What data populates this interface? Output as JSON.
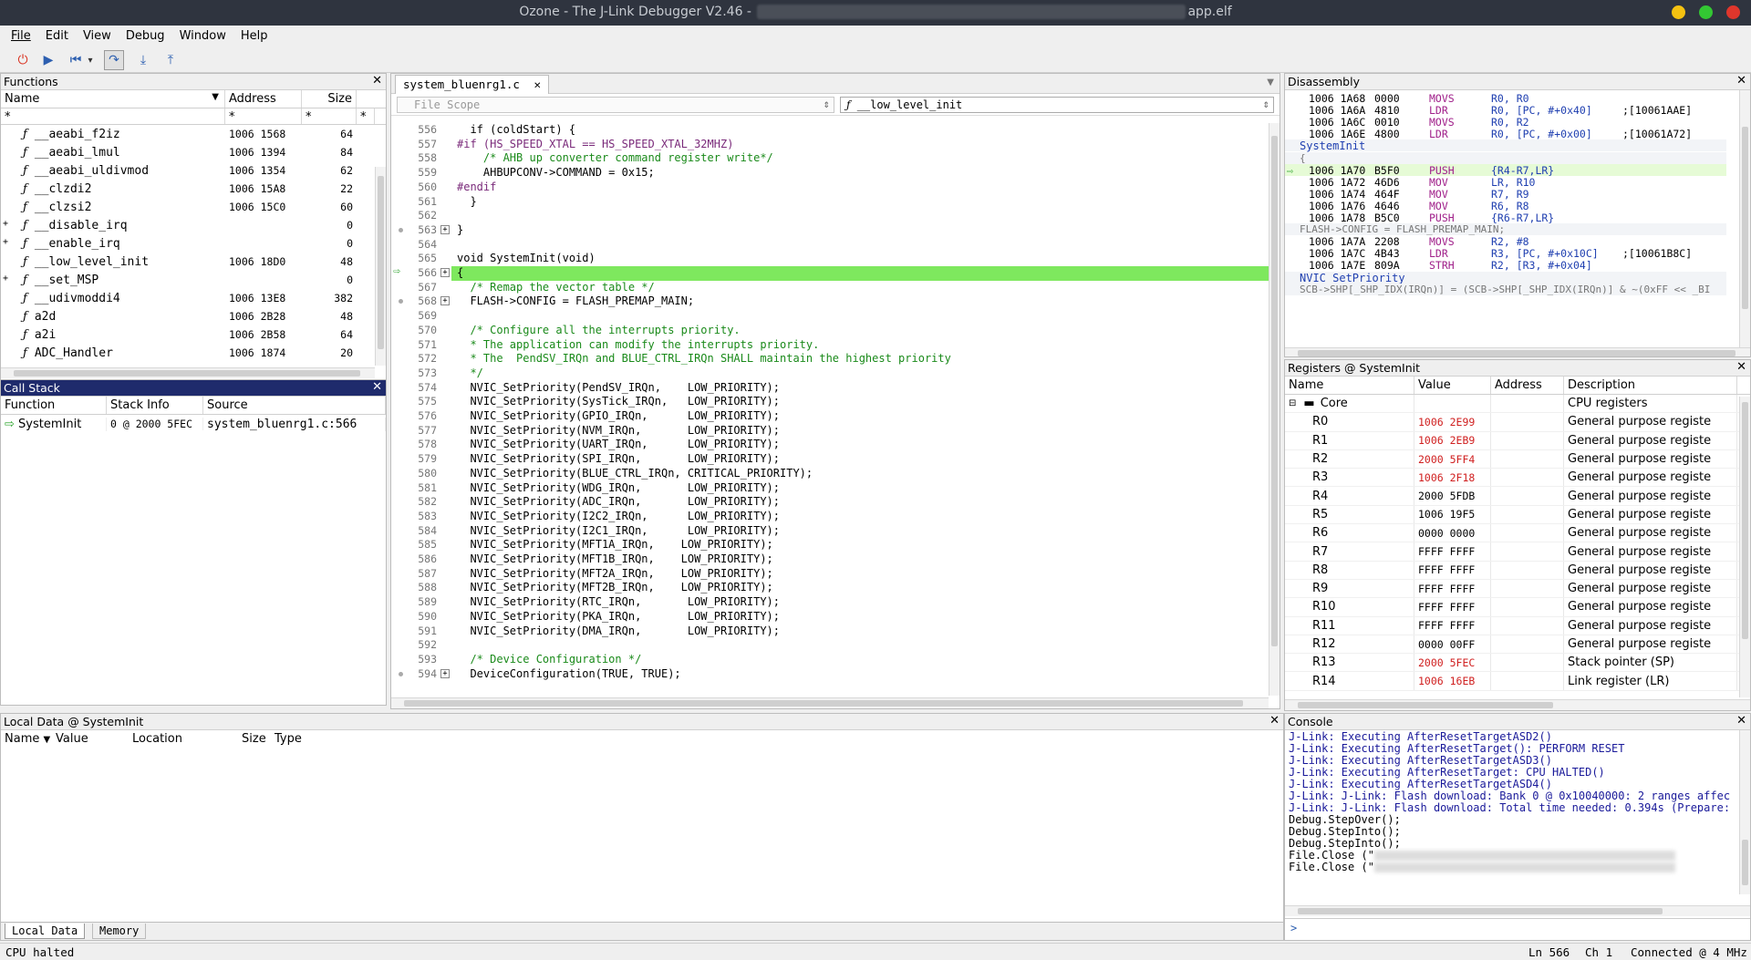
{
  "window": {
    "title_prefix": "Ozone - The J-Link Debugger V2.46 -",
    "title_suffix": "app.elf"
  },
  "menu": [
    "File",
    "Edit",
    "View",
    "Debug",
    "Window",
    "Help"
  ],
  "functions": {
    "title": "Functions",
    "headers": [
      "Name",
      "Address",
      "Size"
    ],
    "filter": [
      "*",
      "*",
      "*",
      "*"
    ],
    "rows": [
      {
        "name": "__aeabi_f2iz",
        "address": "1006 1568",
        "size": "64",
        "exp": ""
      },
      {
        "name": "__aeabi_lmul",
        "address": "1006 1394",
        "size": "84",
        "exp": ""
      },
      {
        "name": "__aeabi_uldivmod",
        "address": "1006 1354",
        "size": "62",
        "exp": ""
      },
      {
        "name": "__clzdi2",
        "address": "1006 15A8",
        "size": "22",
        "exp": ""
      },
      {
        "name": "__clzsi2",
        "address": "1006 15C0",
        "size": "60",
        "exp": ""
      },
      {
        "name": "__disable_irq",
        "address": "",
        "size": "0",
        "exp": "+"
      },
      {
        "name": "__enable_irq",
        "address": "",
        "size": "0",
        "exp": "+"
      },
      {
        "name": "__low_level_init",
        "address": "1006 18D0",
        "size": "48",
        "exp": ""
      },
      {
        "name": "__set_MSP",
        "address": "",
        "size": "0",
        "exp": "+"
      },
      {
        "name": "__udivmoddi4",
        "address": "1006 13E8",
        "size": "382",
        "exp": ""
      },
      {
        "name": "a2d",
        "address": "1006 2B28",
        "size": "48",
        "exp": ""
      },
      {
        "name": "a2i",
        "address": "1006 2B58",
        "size": "64",
        "exp": ""
      },
      {
        "name": "ADC_Handler",
        "address": "1006 1874",
        "size": "20",
        "exp": ""
      }
    ]
  },
  "callstack": {
    "title": "Call Stack",
    "headers": [
      "Function",
      "Stack Info",
      "Source"
    ],
    "rows": [
      {
        "function": "SystemInit",
        "stack": "0 @ 2000 5FEC",
        "source": "system_bluenrg1.c:566"
      }
    ]
  },
  "localdata": {
    "title": "Local Data @ SystemInit",
    "headers": [
      "Name",
      "Value",
      "Location",
      "Size",
      "Type"
    ],
    "tabs": [
      "Local Data",
      "Memory"
    ]
  },
  "editor": {
    "tab": "system_bluenrg1.c",
    "scope": "File Scope",
    "function": "__low_level_init",
    "lines": [
      {
        "n": "556",
        "t": "  if (coldStart) {",
        "c": ""
      },
      {
        "n": "557",
        "t": "#if (HS_SPEED_XTAL == HS_SPEED_XTAL_32MHZ)",
        "c": "pp"
      },
      {
        "n": "558",
        "t": "    /* AHB up converter command register write*/",
        "c": "cm"
      },
      {
        "n": "559",
        "t": "    AHBUPCONV->COMMAND = 0x15;",
        "c": ""
      },
      {
        "n": "560",
        "t": "#endif",
        "c": "pp"
      },
      {
        "n": "561",
        "t": "  }",
        "c": ""
      },
      {
        "n": "562",
        "t": "",
        "c": ""
      },
      {
        "n": "563",
        "t": "}",
        "c": "",
        "mk": "+"
      },
      {
        "n": "564",
        "t": "",
        "c": ""
      },
      {
        "n": "565",
        "t": "void SystemInit(void)",
        "c": ""
      },
      {
        "n": "566",
        "t": "{",
        "c": "",
        "mk": "+",
        "cur": "1"
      },
      {
        "n": "567",
        "t": "  /* Remap the vector table */",
        "c": "cm"
      },
      {
        "n": "568",
        "t": "  FLASH->CONFIG = FLASH_PREMAP_MAIN;",
        "c": "",
        "mk": "+"
      },
      {
        "n": "569",
        "t": "",
        "c": ""
      },
      {
        "n": "570",
        "t": "  /* Configure all the interrupts priority.",
        "c": "cm"
      },
      {
        "n": "571",
        "t": "  * The application can modify the interrupts priority.",
        "c": "cm"
      },
      {
        "n": "572",
        "t": "  * The  PendSV_IRQn and BLUE_CTRL_IRQn SHALL maintain the highest priority",
        "c": "cm"
      },
      {
        "n": "573",
        "t": "  */",
        "c": "cm"
      },
      {
        "n": "574",
        "t": "  NVIC_SetPriority(PendSV_IRQn,    LOW_PRIORITY);",
        "c": ""
      },
      {
        "n": "575",
        "t": "  NVIC_SetPriority(SysTick_IRQn,   LOW_PRIORITY);",
        "c": ""
      },
      {
        "n": "576",
        "t": "  NVIC_SetPriority(GPIO_IRQn,      LOW_PRIORITY);",
        "c": ""
      },
      {
        "n": "577",
        "t": "  NVIC_SetPriority(NVM_IRQn,       LOW_PRIORITY);",
        "c": ""
      },
      {
        "n": "578",
        "t": "  NVIC_SetPriority(UART_IRQn,      LOW_PRIORITY);",
        "c": ""
      },
      {
        "n": "579",
        "t": "  NVIC_SetPriority(SPI_IRQn,       LOW_PRIORITY);",
        "c": ""
      },
      {
        "n": "580",
        "t": "  NVIC_SetPriority(BLUE_CTRL_IRQn, CRITICAL_PRIORITY);",
        "c": ""
      },
      {
        "n": "581",
        "t": "  NVIC_SetPriority(WDG_IRQn,       LOW_PRIORITY);",
        "c": ""
      },
      {
        "n": "582",
        "t": "  NVIC_SetPriority(ADC_IRQn,       LOW_PRIORITY);",
        "c": ""
      },
      {
        "n": "583",
        "t": "  NVIC_SetPriority(I2C2_IRQn,      LOW_PRIORITY);",
        "c": ""
      },
      {
        "n": "584",
        "t": "  NVIC_SetPriority(I2C1_IRQn,      LOW_PRIORITY);",
        "c": ""
      },
      {
        "n": "585",
        "t": "  NVIC_SetPriority(MFT1A_IRQn,    LOW_PRIORITY);",
        "c": ""
      },
      {
        "n": "586",
        "t": "  NVIC_SetPriority(MFT1B_IRQn,    LOW_PRIORITY);",
        "c": ""
      },
      {
        "n": "587",
        "t": "  NVIC_SetPriority(MFT2A_IRQn,    LOW_PRIORITY);",
        "c": ""
      },
      {
        "n": "588",
        "t": "  NVIC_SetPriority(MFT2B_IRQn,    LOW_PRIORITY);",
        "c": ""
      },
      {
        "n": "589",
        "t": "  NVIC_SetPriority(RTC_IRQn,       LOW_PRIORITY);",
        "c": ""
      },
      {
        "n": "590",
        "t": "  NVIC_SetPriority(PKA_IRQn,       LOW_PRIORITY);",
        "c": ""
      },
      {
        "n": "591",
        "t": "  NVIC_SetPriority(DMA_IRQn,       LOW_PRIORITY);",
        "c": ""
      },
      {
        "n": "592",
        "t": "",
        "c": ""
      },
      {
        "n": "593",
        "t": "  /* Device Configuration */",
        "c": "cm"
      },
      {
        "n": "594",
        "t": "  DeviceConfiguration(TRUE, TRUE);",
        "c": "",
        "mk": "+"
      }
    ]
  },
  "disassembly": {
    "title": "Disassembly",
    "lines": [
      {
        "k": "i",
        "a": "1006 1A68",
        "h": "0000",
        "m": "MOVS",
        "o": "R0, R0",
        "cm": ""
      },
      {
        "k": "i",
        "a": "1006 1A6A",
        "h": "4810",
        "m": "LDR",
        "o": "R0, [PC, #+0x40]",
        "cm": ";[10061AAE]"
      },
      {
        "k": "i",
        "a": "1006 1A6C",
        "h": "0010",
        "m": "MOVS",
        "o": "R0, R2",
        "cm": ""
      },
      {
        "k": "i",
        "a": "1006 1A6E",
        "h": "4800",
        "m": "LDR",
        "o": "R0, [PC, #+0x00]",
        "cm": ";[10061A72]"
      },
      {
        "k": "l",
        "t": "SystemInit"
      },
      {
        "k": "s",
        "t": "{"
      },
      {
        "k": "i",
        "a": "1006 1A70",
        "h": "B5F0",
        "m": "PUSH",
        "o": "{R4-R7,LR}",
        "cm": "",
        "cur": "1"
      },
      {
        "k": "i",
        "a": "1006 1A72",
        "h": "46D6",
        "m": "MOV",
        "o": "LR, R10",
        "cm": ""
      },
      {
        "k": "i",
        "a": "1006 1A74",
        "h": "464F",
        "m": "MOV",
        "o": "R7, R9",
        "cm": ""
      },
      {
        "k": "i",
        "a": "1006 1A76",
        "h": "4646",
        "m": "MOV",
        "o": "R6, R8",
        "cm": ""
      },
      {
        "k": "i",
        "a": "1006 1A78",
        "h": "B5C0",
        "m": "PUSH",
        "o": "{R6-R7,LR}",
        "cm": ""
      },
      {
        "k": "s",
        "t": "FLASH->CONFIG = FLASH_PREMAP_MAIN;"
      },
      {
        "k": "i",
        "a": "1006 1A7A",
        "h": "2208",
        "m": "MOVS",
        "o": "R2, #8",
        "cm": ""
      },
      {
        "k": "i",
        "a": "1006 1A7C",
        "h": "4B43",
        "m": "LDR",
        "o": "R3, [PC, #+0x10C]",
        "cm": ";[10061B8C]"
      },
      {
        "k": "i",
        "a": "1006 1A7E",
        "h": "809A",
        "m": "STRH",
        "o": "R2, [R3, #+0x04]",
        "cm": ""
      },
      {
        "k": "l",
        "t": "NVIC_SetPriority"
      },
      {
        "k": "s",
        "t": "SCB->SHP[_SHP_IDX(IRQn)] = (SCB->SHP[_SHP_IDX(IRQn)] & ~(0xFF << _BI"
      }
    ]
  },
  "registers": {
    "title": "Registers @ SystemInit",
    "headers": [
      "Name",
      "Value",
      "Address",
      "Description"
    ],
    "group": {
      "name": "Core",
      "desc": "CPU registers"
    },
    "rows": [
      {
        "n": "R0",
        "v": "1006 2E99",
        "d": "General purpose registe",
        "red": "1"
      },
      {
        "n": "R1",
        "v": "1006 2EB9",
        "d": "General purpose registe",
        "red": "1"
      },
      {
        "n": "R2",
        "v": "2000 5FF4",
        "d": "General purpose registe",
        "red": "1"
      },
      {
        "n": "R3",
        "v": "1006 2F18",
        "d": "General purpose registe",
        "red": "1"
      },
      {
        "n": "R4",
        "v": "2000 5FDB",
        "d": "General purpose registe",
        "red": ""
      },
      {
        "n": "R5",
        "v": "1006 19F5",
        "d": "General purpose registe",
        "red": ""
      },
      {
        "n": "R6",
        "v": "0000 0000",
        "d": "General purpose registe",
        "red": ""
      },
      {
        "n": "R7",
        "v": "FFFF FFFF",
        "d": "General purpose registe",
        "red": ""
      },
      {
        "n": "R8",
        "v": "FFFF FFFF",
        "d": "General purpose registe",
        "red": ""
      },
      {
        "n": "R9",
        "v": "FFFF FFFF",
        "d": "General purpose registe",
        "red": ""
      },
      {
        "n": "R10",
        "v": "FFFF FFFF",
        "d": "General purpose registe",
        "red": ""
      },
      {
        "n": "R11",
        "v": "FFFF FFFF",
        "d": "General purpose registe",
        "red": ""
      },
      {
        "n": "R12",
        "v": "0000 00FF",
        "d": "General purpose registe",
        "red": ""
      },
      {
        "n": "R13",
        "v": "2000 5FEC",
        "d": "Stack pointer (SP)",
        "red": "1"
      },
      {
        "n": "R14",
        "v": "1006 16EB",
        "d": "Link register (LR)",
        "red": "1"
      }
    ]
  },
  "console": {
    "title": "Console",
    "lines": [
      {
        "t": "J-Link: Executing AfterResetTargetASD2()",
        "b": ""
      },
      {
        "t": "J-Link: Executing AfterResetTarget(): PERFORM RESET",
        "b": ""
      },
      {
        "t": "J-Link: Executing AfterResetTargetASD3()",
        "b": ""
      },
      {
        "t": "J-Link: Executing AfterResetTarget: CPU HALTED()",
        "b": ""
      },
      {
        "t": "J-Link: Executing AfterResetTargetASD4()",
        "b": ""
      },
      {
        "t": "J-Link: J-Link: Flash download: Bank 0 @ 0x10040000: 2 ranges affec",
        "b": ""
      },
      {
        "t": "J-Link: J-Link: Flash download: Total time needed: 0.394s (Prepare:",
        "b": ""
      },
      {
        "t": "Debug.StepOver();",
        "b": "1"
      },
      {
        "t": "Debug.StepInto();",
        "b": "1"
      },
      {
        "t": "Debug.StepInto();",
        "b": "1"
      },
      {
        "t": "File.Close (\"",
        "b": "1"
      },
      {
        "t": "File.Close (\"",
        "b": "1"
      }
    ],
    "prompt": ">"
  },
  "status": {
    "left": "CPU halted",
    "ln": "Ln 566",
    "ch": "Ch 1",
    "conn": "Connected @ 4 MHz"
  }
}
